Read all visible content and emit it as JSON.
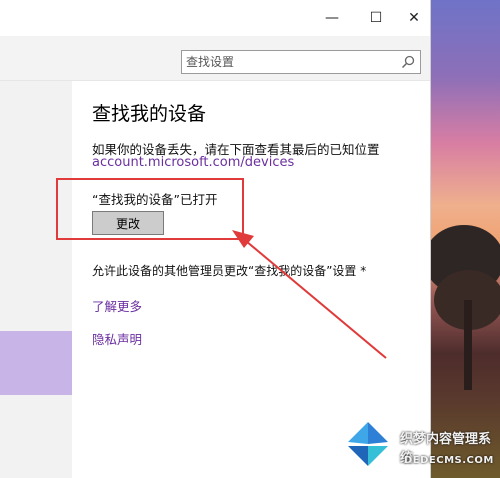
{
  "window": {
    "controls": {
      "minimize": "—",
      "maximize": "☐",
      "close": "✕"
    }
  },
  "search": {
    "placeholder": "查找设置",
    "icon": "search-icon"
  },
  "main": {
    "title": "查找我的设备",
    "lost_description": "如果你的设备丢失，请在下面查看其最后的已知位置",
    "devices_link": "account.microsoft.com/devices",
    "status": "“查找我的设备”已打开",
    "change_button": "更改",
    "admin_text": "允许此设备的其他管理员更改“查找我的设备”设置 *",
    "learn_more": "了解更多",
    "privacy": "隐私声明"
  },
  "watermark": {
    "text": "织梦内容管理系统",
    "url": "DEDECMS.COM"
  },
  "colors": {
    "link": "#6b2fa0",
    "highlight": "#e03a3a",
    "nav_selected": "#c8b4e6"
  }
}
